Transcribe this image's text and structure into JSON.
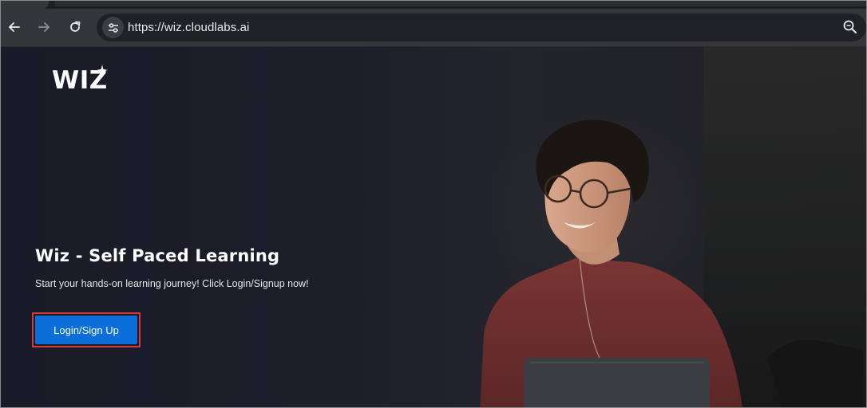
{
  "browser": {
    "url": "https://wiz.cloudlabs.ai",
    "icons": {
      "back": "back-arrow-icon",
      "forward": "forward-arrow-icon",
      "reload": "reload-icon",
      "site_info": "tune-icon",
      "zoom": "zoom-icon"
    }
  },
  "page": {
    "logo_text": "WIZ",
    "title": "Wiz - Self Paced Learning",
    "subtitle": "Start your hands-on learning journey! Click Login/Signup now!",
    "cta_label": "Login/Sign Up"
  },
  "colors": {
    "cta": "#0b6ed9",
    "highlight": "#d83a3a",
    "toolbar": "#35363a",
    "omnibox": "#202124"
  }
}
